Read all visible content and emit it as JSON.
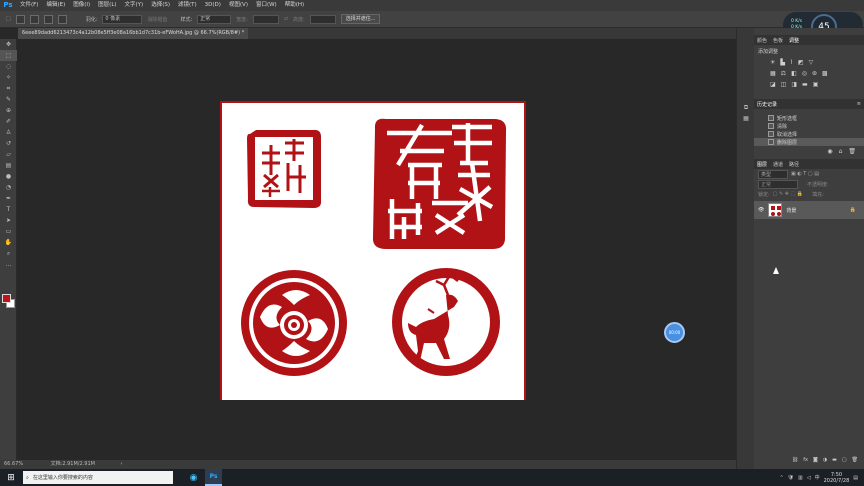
{
  "app": {
    "logo": "Ps"
  },
  "menu": [
    "文件(F)",
    "编辑(E)",
    "图像(I)",
    "图层(L)",
    "文字(Y)",
    "选择(S)",
    "滤镜(T)",
    "3D(D)",
    "视图(V)",
    "窗口(W)",
    "帮助(H)"
  ],
  "options": {
    "feather_label": "羽化:",
    "feather_value": "0 像素",
    "antialias": "消除锯齿",
    "style_label": "样式:",
    "style_value": "正常",
    "width_label": "宽度:",
    "height_label": "高度:",
    "select_mask_button": "选择并遮住..."
  },
  "document": {
    "tab_title": "6eee89dadd6213473c4a12b08e5ff3e08a16bb1d7c31b-eFWoHA.jpg @ 66.7%(RGB/8#) *"
  },
  "status": {
    "zoom": "66.67%",
    "doc_size": "文档:2.91M/2.91M"
  },
  "dock": {
    "tabs": [
      "颜色",
      "色板",
      "调整"
    ]
  },
  "adjustments": {
    "title": "添加调整"
  },
  "history": {
    "title": "历史记录",
    "items": [
      "矩形选框",
      "清除",
      "取消选择",
      "删除图层"
    ]
  },
  "layers": {
    "tabs": [
      "图层",
      "通道",
      "路径"
    ],
    "kind_label": "类型",
    "blend_mode": "正常",
    "opacity_label": "不透明度:",
    "lock_label": "锁定:",
    "fill_label": "填充:",
    "layer_name": "背景"
  },
  "overlay": {
    "percent": "45",
    "up_speed": "0 K/s",
    "down_speed": "0 K/s",
    "timer": "00:00"
  },
  "taskbar": {
    "search_placeholder": "在这里输入你要搜索的内容",
    "time": "7:50",
    "date": "2020/7/28"
  },
  "colors": {
    "accent": "#31a8ff",
    "seal_red": "#b01216",
    "foreground": "#c0141b",
    "background": "#ffffff"
  }
}
